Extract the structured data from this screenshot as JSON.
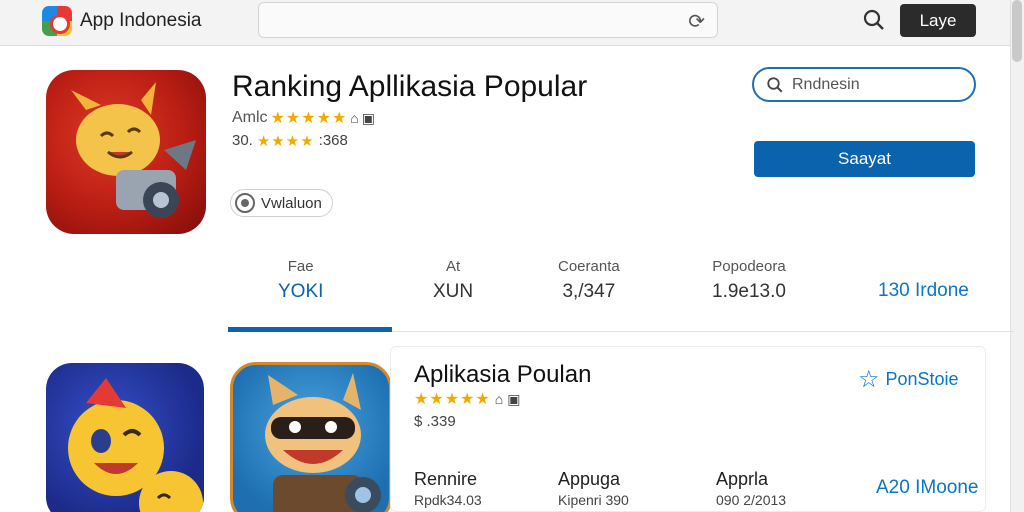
{
  "header": {
    "app_title": "App Indonesia",
    "action_button": "Laye"
  },
  "hero": {
    "title": "Ranking Apllikasia Popular",
    "rating_prefix": "Amlc",
    "rating_stars": "★★★★★",
    "sub_prefix": "30.",
    "sub_stars": "★★★★",
    "sub_suffix": ":368",
    "chip_label": "Vwlaluon",
    "search_placeholder": "Rndnesin",
    "primary_button": "Saayat"
  },
  "stats": [
    {
      "label": "Fae",
      "value": "YOKI"
    },
    {
      "label": "At",
      "value": "XUN"
    },
    {
      "label": "Coeranta",
      "value": "3,/347"
    },
    {
      "label": "Popodeora",
      "value": "1.9e13.0"
    }
  ],
  "stats_link": "130 Irdone",
  "card2": {
    "title": "Aplikasia Poulan",
    "stars": "★★★★★",
    "price": "$ .339",
    "fav_label": "PonStoie",
    "details": [
      {
        "label": "Rennire",
        "value": "Rpdk34.03"
      },
      {
        "label": "Appuga",
        "value": "Kipenri 390"
      },
      {
        "label": "Apprla",
        "value": "090 2/2013"
      }
    ],
    "link": "A20 IMoone"
  },
  "colors": {
    "accent": "#0b63ad",
    "star": "#f2a900",
    "hero_icon": "#c0201a"
  },
  "icons": [
    "app-logo-icon",
    "reload-icon",
    "search-icon",
    "share-icon",
    "menu-icon",
    "star-outline-icon"
  ]
}
